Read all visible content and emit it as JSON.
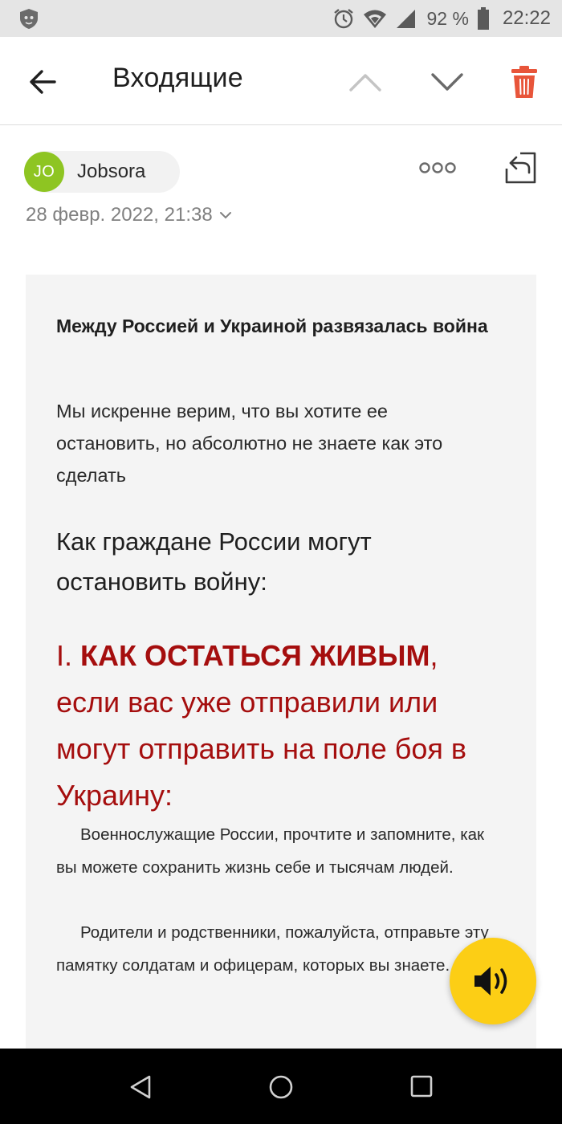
{
  "status_bar": {
    "battery_percent": "92 %",
    "time": "22:22",
    "icons": [
      "app-shield-icon",
      "alarm-icon",
      "wifi-icon",
      "signal-icon",
      "battery-icon"
    ]
  },
  "toolbar": {
    "title": "Входящие",
    "icons": [
      "back-arrow-icon",
      "chevron-up-icon",
      "chevron-down-icon",
      "trash-icon"
    ],
    "trash_color": "#e8553a"
  },
  "sender": {
    "avatar_initials": "JO",
    "avatar_color": "#8ec522",
    "name": "Jobsora",
    "date": "28 февр. 2022, 21:38"
  },
  "message": {
    "headline": "Между Россией и Украиной развязалась война",
    "intro": "Мы искренне верим, что вы хотите ее остановить, но абсолютно не знаете как это сделать",
    "subhead": "Как граждане России могут остановить войну:",
    "section": {
      "number": "I. ",
      "bold": "КАК ОСТАТЬСЯ ЖИВЫМ",
      "rest": ", если вас уже отправили или могут отправить на поле боя в Украину:",
      "color": "#a50e0e"
    },
    "paragraph1": "Военнослужащие России, прочтите и запомните, как вы можете сохранить жизнь себе и тысячам людей.",
    "paragraph2": "Родители и родственники, пожалуйста, отправьте эту памятку солдатам и офицерам, которых вы знаете."
  },
  "fab": {
    "icon": "speaker-icon",
    "color": "#fcce15"
  },
  "nav_bar": {
    "icons": [
      "nav-back-icon",
      "nav-home-icon",
      "nav-recent-icon"
    ]
  }
}
